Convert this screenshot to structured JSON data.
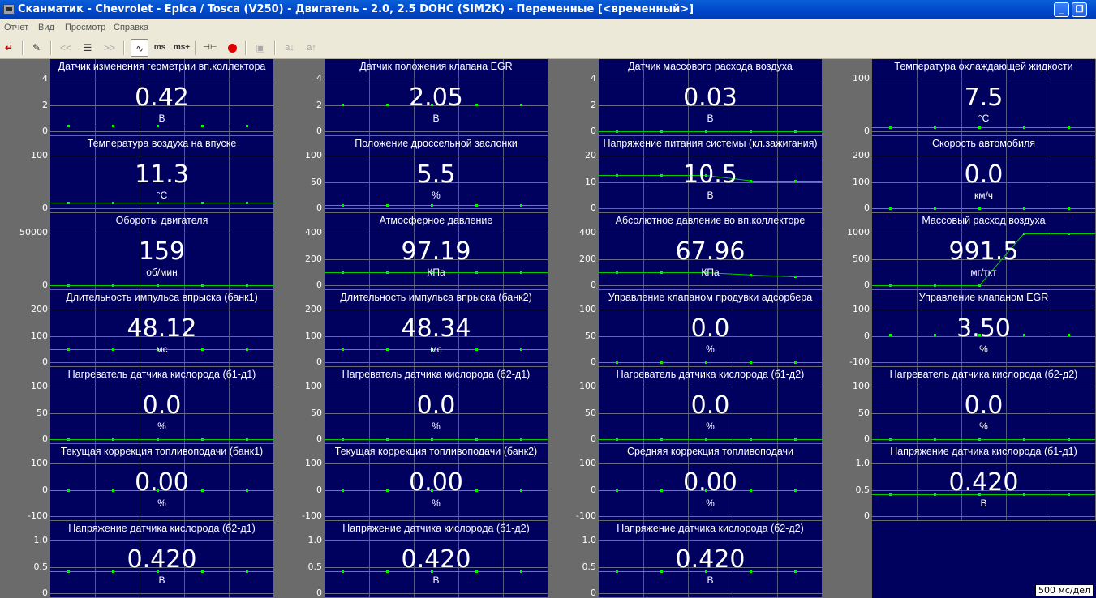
{
  "window": {
    "title": "Сканматик - Chevrolet - Epica / Tosca (V250) - Двигатель - 2.0, 2.5 DOHC (SIM2K) - Переменные [<временный>]",
    "minimize_label": "_",
    "maximize_label": "❐",
    "close_label": "✕"
  },
  "menu": [
    "Отчет",
    "Вид",
    "Просмотр",
    "Справка"
  ],
  "toolbar": {
    "exit_icon": "↵",
    "edit_icon": "✎",
    "rewind_icon": "<<",
    "list_icon": "☰",
    "forward_icon": ">>",
    "wave_icon": "∿",
    "ms_minus_label": "ms",
    "ms_plus_label": "ms+",
    "marker_icon": "⊣⊢",
    "record_color": "#e00000",
    "save_icon": "▣",
    "font_down_label": "a↓",
    "font_up_label": "a↑"
  },
  "time_scale": "500 мс/дел",
  "panels": [
    {
      "title": "Датчик изменения геометрии вп.коллектора",
      "value": "0.42",
      "unit": "В",
      "ylabels": [
        "4",
        "2",
        "0"
      ],
      "line": [
        0.42,
        0.42,
        0.42,
        0.42,
        0.42
      ]
    },
    {
      "title": "Датчик положения клапана EGR",
      "value": "2.05",
      "unit": "В",
      "ylabels": [
        "4",
        "2",
        "0"
      ],
      "line": [
        2.05,
        2.05,
        2.05,
        2.05,
        2.05
      ]
    },
    {
      "title": "Датчик массового расхода воздуха",
      "value": "0.03",
      "unit": "В",
      "ylabels": [
        "4",
        "2",
        "0"
      ],
      "line": [
        0.03,
        0.03,
        0.03,
        0.03,
        0.03
      ]
    },
    {
      "title": "Температура охлаждающей жидкости",
      "value": "7.5",
      "unit": "°C",
      "ylabels": [
        "100",
        "0"
      ],
      "line": [
        7.5,
        7.5,
        7.5,
        7.5,
        7.5
      ]
    },
    {
      "title": "Температура воздуха на впуске",
      "value": "11.3",
      "unit": "°C",
      "ylabels": [
        "100",
        "0"
      ],
      "line": [
        11.3,
        11.3,
        11.3,
        11.3,
        11.3
      ]
    },
    {
      "title": "Положение дроссельной заслонки",
      "value": "5.5",
      "unit": "%",
      "ylabels": [
        "100",
        "50",
        "0"
      ],
      "line": [
        5.5,
        5.5,
        5.5,
        5.5,
        5.5
      ]
    },
    {
      "title": "Напряжение питания системы (кл.зажигания)",
      "value": "10.5",
      "unit": "В",
      "ylabels": [
        "20",
        "10",
        "0"
      ],
      "line": [
        12.5,
        12.5,
        12.5,
        10.5,
        10.5
      ]
    },
    {
      "title": "Скорость автомобиля",
      "value": "0.0",
      "unit": "км/ч",
      "ylabels": [
        "200",
        "100",
        "0"
      ],
      "line": [
        0,
        0,
        0,
        0,
        0
      ]
    },
    {
      "title": "Обороты двигателя",
      "value": "159",
      "unit": "об/мин",
      "ylabels": [
        "50000",
        "0"
      ],
      "line": [
        159,
        159,
        159,
        159,
        159
      ]
    },
    {
      "title": "Атмосферное давление",
      "value": "97.19",
      "unit": "КПа",
      "ylabels": [
        "400",
        "200",
        "0"
      ],
      "line": [
        97.19,
        97.19,
        97.19,
        97.19,
        97.19
      ]
    },
    {
      "title": "Абсолютное давление во вп.коллекторе",
      "value": "67.96",
      "unit": "КПа",
      "ylabels": [
        "400",
        "200",
        "0"
      ],
      "line": [
        97,
        97,
        97,
        80,
        67.96
      ]
    },
    {
      "title": "Массовый расход воздуха",
      "value": "991.5",
      "unit": "мг/ткт",
      "ylabels": [
        "1000",
        "500",
        "0"
      ],
      "line": [
        0,
        0,
        0,
        991.5,
        991.5
      ]
    },
    {
      "title": "Длительность импульса впрыска (банк1)",
      "value": "48.12",
      "unit": "мс",
      "ylabels": [
        "200",
        "100",
        "0"
      ],
      "line": [
        48.12,
        48.12,
        48.12,
        48.12,
        48.12
      ]
    },
    {
      "title": "Длительность импульса впрыска (банк2)",
      "value": "48.34",
      "unit": "мс",
      "ylabels": [
        "200",
        "100",
        "0"
      ],
      "line": [
        48.34,
        48.34,
        48.34,
        48.34,
        48.34
      ]
    },
    {
      "title": "Управление клапаном продувки адсорбера",
      "value": "0.0",
      "unit": "%",
      "ylabels": [
        "100",
        "50",
        "0"
      ],
      "line": [
        0,
        0,
        0,
        0,
        0
      ]
    },
    {
      "title": "Управление клапаном EGR",
      "value": "3.50",
      "unit": "%",
      "ylabels": [
        "100",
        "0",
        "-100"
      ],
      "line": [
        3.5,
        3.5,
        3.5,
        3.5,
        3.5
      ]
    },
    {
      "title": "Нагреватель датчика кислорода (б1-д1)",
      "value": "0.0",
      "unit": "%",
      "ylabels": [
        "100",
        "50",
        "0"
      ],
      "line": [
        0,
        0,
        0,
        0,
        0
      ]
    },
    {
      "title": "Нагреватель датчика кислорода (б2-д1)",
      "value": "0.0",
      "unit": "%",
      "ylabels": [
        "100",
        "50",
        "0"
      ],
      "line": [
        0,
        0,
        0,
        0,
        0
      ]
    },
    {
      "title": "Нагреватель датчика кислорода (б1-д2)",
      "value": "0.0",
      "unit": "%",
      "ylabels": [
        "100",
        "50",
        "0"
      ],
      "line": [
        0,
        0,
        0,
        0,
        0
      ]
    },
    {
      "title": "Нагреватель датчика кислорода (б2-д2)",
      "value": "0.0",
      "unit": "%",
      "ylabels": [
        "100",
        "50",
        "0"
      ],
      "line": [
        0,
        0,
        0,
        0,
        0
      ]
    },
    {
      "title": "Текущая коррекция топливоподачи (банк1)",
      "value": "0.00",
      "unit": "%",
      "ylabels": [
        "100",
        "0",
        "-100"
      ],
      "line": [
        0,
        0,
        0,
        0,
        0
      ]
    },
    {
      "title": "Текущая коррекция топливоподачи (банк2)",
      "value": "0.00",
      "unit": "%",
      "ylabels": [
        "100",
        "0",
        "-100"
      ],
      "line": [
        0,
        0,
        0,
        0,
        0
      ]
    },
    {
      "title": "Средняя коррекция топливоподачи",
      "value": "0.00",
      "unit": "%",
      "ylabels": [
        "100",
        "0",
        "-100"
      ],
      "line": [
        0,
        0,
        0,
        0,
        0
      ]
    },
    {
      "title": "Напряжение датчика кислорода (б1-д1)",
      "value": "0.420",
      "unit": "В",
      "ylabels": [
        "1.0",
        "0.5",
        "0"
      ],
      "line": [
        0.42,
        0.42,
        0.42,
        0.42,
        0.42
      ]
    },
    {
      "title": "Напряжение датчика кислорода (б2-д1)",
      "value": "0.420",
      "unit": "В",
      "ylabels": [
        "1.0",
        "0.5",
        "0"
      ],
      "line": [
        0.42,
        0.42,
        0.42,
        0.42,
        0.42
      ]
    },
    {
      "title": "Напряжение датчика кислорода (б1-д2)",
      "value": "0.420",
      "unit": "В",
      "ylabels": [
        "1.0",
        "0.5",
        "0"
      ],
      "line": [
        0.42,
        0.42,
        0.42,
        0.42,
        0.42
      ]
    },
    {
      "title": "Напряжение датчика кислорода (б2-д2)",
      "value": "0.420",
      "unit": "В",
      "ylabels": [
        "1.0",
        "0.5",
        "0"
      ],
      "line": [
        0.42,
        0.42,
        0.42,
        0.42,
        0.42
      ]
    }
  ]
}
